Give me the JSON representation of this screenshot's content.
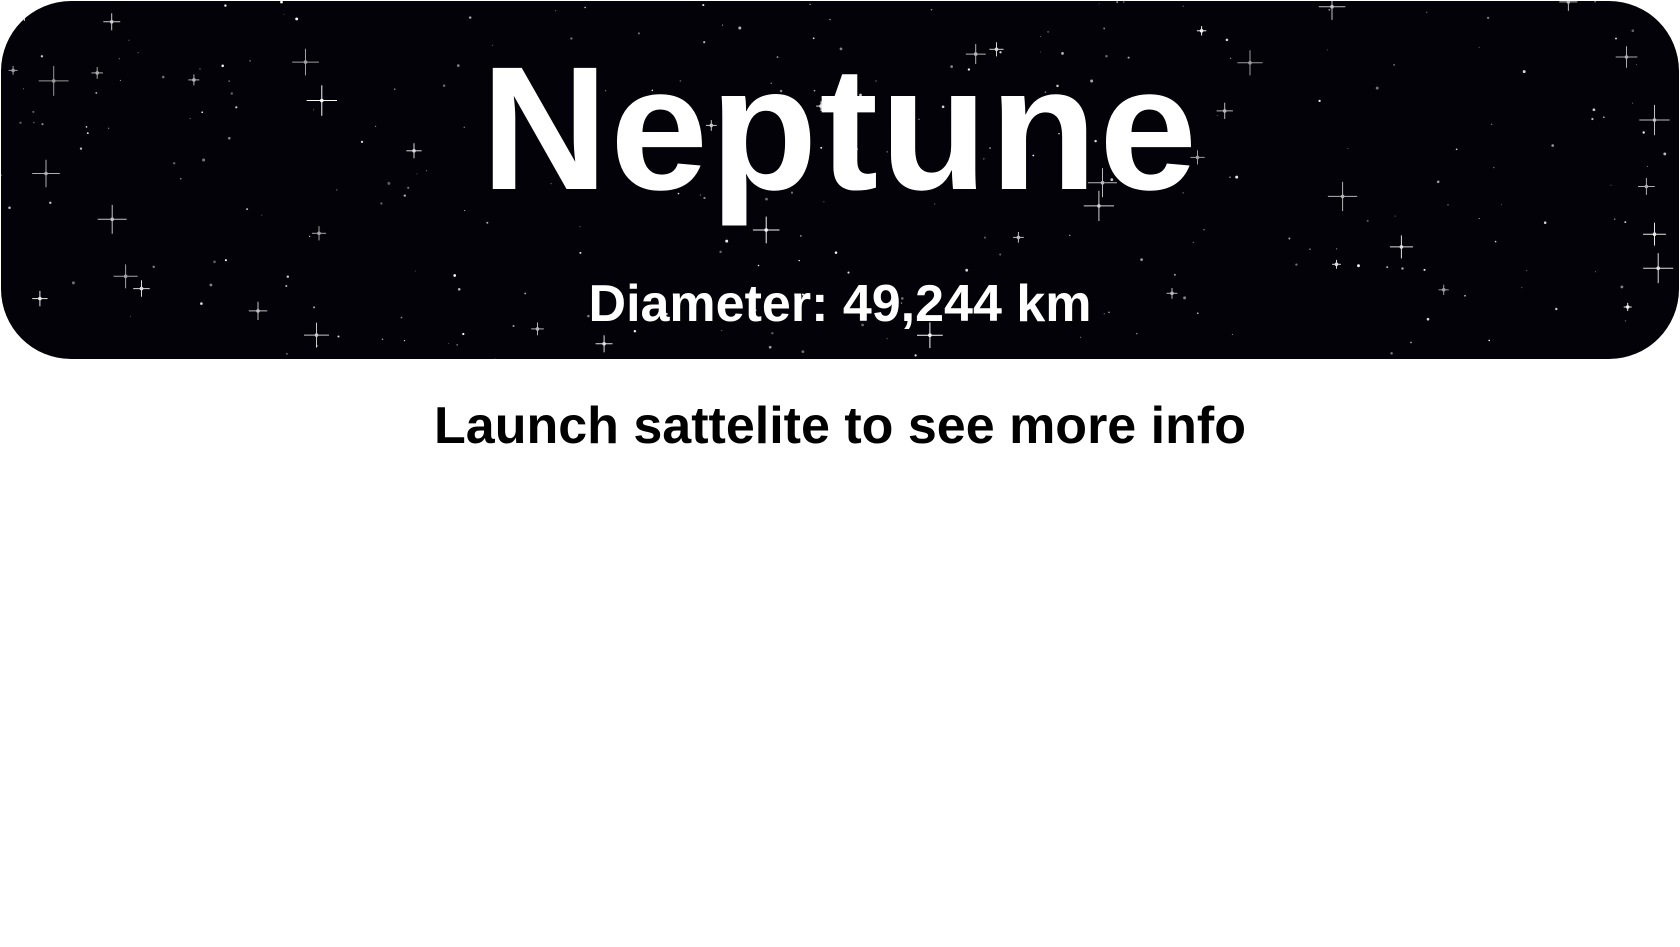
{
  "planet": {
    "name": "Neptune",
    "diameter_text": "Diameter: 49,244 km"
  },
  "message": {
    "text": "Launch sattelite to see more info"
  },
  "colors": {
    "banner_background": "#020208",
    "banner_text": "#ffffff",
    "page_background": "#ffffff",
    "message_text": "#000000"
  }
}
